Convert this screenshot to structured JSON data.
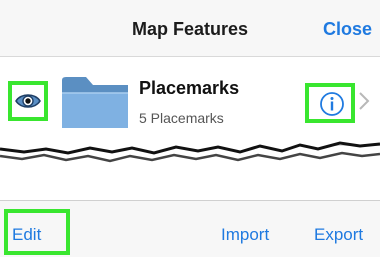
{
  "header": {
    "title": "Map Features",
    "close_label": "Close"
  },
  "list": {
    "items": [
      {
        "title": "Placemarks",
        "subtitle": "5 Placemarks",
        "leading_icon": "eye-icon",
        "type_icon": "folder-icon",
        "accessory_icon": "info-icon",
        "disclosure_icon": "chevron-right-icon"
      }
    ]
  },
  "toolbar": {
    "edit_label": "Edit",
    "import_label": "Import",
    "export_label": "Export"
  },
  "colors": {
    "accent": "#1f7ae0",
    "highlight": "#39e62f",
    "folder": "#6b9bc8",
    "bar_background": "#f7f7f7"
  }
}
